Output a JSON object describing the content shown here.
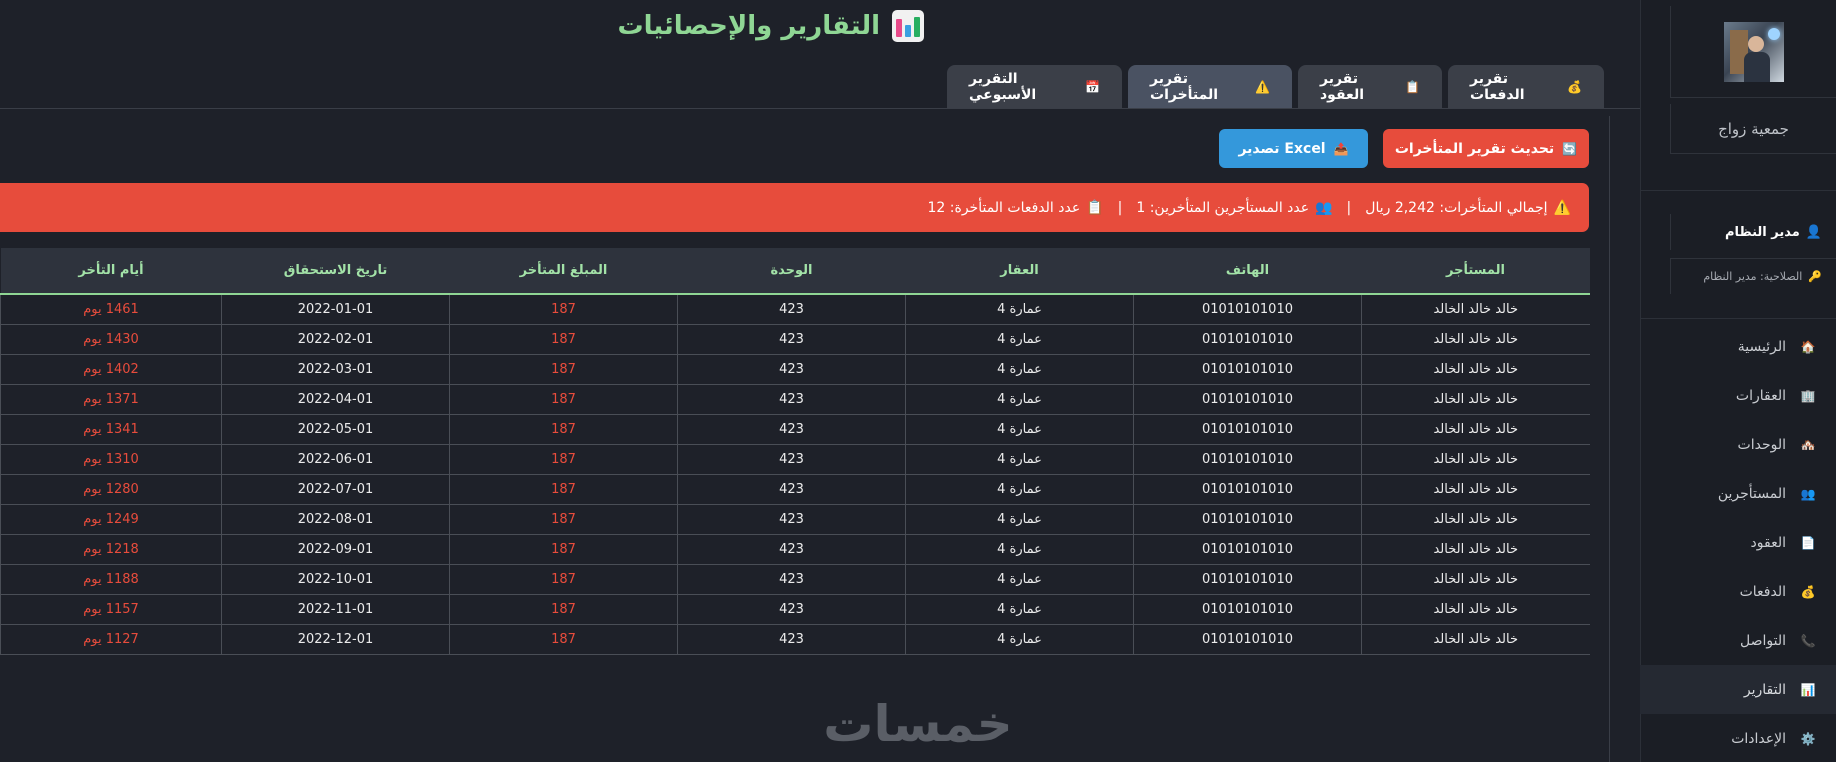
{
  "header": {
    "title": "التقارير والإحصائيات",
    "title_icon": "bar-chart-icon"
  },
  "tabs": [
    {
      "label": "تقرير الدفعات",
      "icon": "💰",
      "active": false
    },
    {
      "label": "تقرير العقود",
      "icon": "📋",
      "active": false
    },
    {
      "label": "تقرير المتأخرات",
      "icon": "⚠️",
      "active": true
    },
    {
      "label": "التقرير الأسبوعي",
      "icon": "📅",
      "active": false
    }
  ],
  "actions": {
    "refresh_label": "تحديث تقرير المتأخرات",
    "refresh_icon": "🔄",
    "export_label": "تصدير Excel",
    "export_icon": "📤"
  },
  "alert": {
    "icon": "⚠️",
    "total_late": "إجمالي المتأخرات: 2,242 ريال",
    "tenants_icon": "👥",
    "tenants_count": "عدد المستأجرين المتأخرين: 1",
    "payments_icon": "📋",
    "payments_count": "عدد الدفعات المتأخرة: 12",
    "separator": "|"
  },
  "table": {
    "columns": [
      "المستأجر",
      "الهاتف",
      "العقار",
      "الوحدة",
      "المبلغ المتأخر",
      "تاريخ الاستحقاق",
      "أيام التأخر"
    ],
    "rows": [
      [
        "خالد خالد الخالد",
        "01010101010",
        "عمارة 4",
        "423",
        "187",
        "2022-01-01",
        "1461 يوم"
      ],
      [
        "خالد خالد الخالد",
        "01010101010",
        "عمارة 4",
        "423",
        "187",
        "2022-02-01",
        "1430 يوم"
      ],
      [
        "خالد خالد الخالد",
        "01010101010",
        "عمارة 4",
        "423",
        "187",
        "2022-03-01",
        "1402 يوم"
      ],
      [
        "خالد خالد الخالد",
        "01010101010",
        "عمارة 4",
        "423",
        "187",
        "2022-04-01",
        "1371 يوم"
      ],
      [
        "خالد خالد الخالد",
        "01010101010",
        "عمارة 4",
        "423",
        "187",
        "2022-05-01",
        "1341 يوم"
      ],
      [
        "خالد خالد الخالد",
        "01010101010",
        "عمارة 4",
        "423",
        "187",
        "2022-06-01",
        "1310 يوم"
      ],
      [
        "خالد خالد الخالد",
        "01010101010",
        "عمارة 4",
        "423",
        "187",
        "2022-07-01",
        "1280 يوم"
      ],
      [
        "خالد خالد الخالد",
        "01010101010",
        "عمارة 4",
        "423",
        "187",
        "2022-08-01",
        "1249 يوم"
      ],
      [
        "خالد خالد الخالد",
        "01010101010",
        "عمارة 4",
        "423",
        "187",
        "2022-09-01",
        "1218 يوم"
      ],
      [
        "خالد خالد الخالد",
        "01010101010",
        "عمارة 4",
        "423",
        "187",
        "2022-10-01",
        "1188 يوم"
      ],
      [
        "خالد خالد الخالد",
        "01010101010",
        "عمارة 4",
        "423",
        "187",
        "2022-11-01",
        "1157 يوم"
      ],
      [
        "خالد خالد الخالد",
        "01010101010",
        "عمارة 4",
        "423",
        "187",
        "2022-12-01",
        "1127 يوم"
      ]
    ]
  },
  "sidebar": {
    "org_name": "جمعية زواج",
    "user_role": "مدير النظام",
    "user_icon": "👤",
    "permission": "الصلاحية: مدير النظام",
    "permission_icon": "🔑",
    "items": [
      {
        "label": "الرئيسية",
        "icon": "🏠",
        "active": false
      },
      {
        "label": "العقارات",
        "icon": "🏢",
        "active": false
      },
      {
        "label": "الوحدات",
        "icon": "🏘️",
        "active": false
      },
      {
        "label": "المستأجرين",
        "icon": "👥",
        "active": false
      },
      {
        "label": "العقود",
        "icon": "📄",
        "active": false
      },
      {
        "label": "الدفعات",
        "icon": "💰",
        "active": false
      },
      {
        "label": "التواصل",
        "icon": "📞",
        "active": false
      },
      {
        "label": "التقارير",
        "icon": "📊",
        "active": true
      },
      {
        "label": "الإعدادات",
        "icon": "⚙️",
        "active": false
      }
    ]
  },
  "watermark": "خمسات",
  "colors": {
    "background": "#1e2129",
    "accent_green": "#8fd694",
    "danger": "#e74c3c",
    "primary": "#3498db",
    "tab_bg": "#3b3f48"
  }
}
